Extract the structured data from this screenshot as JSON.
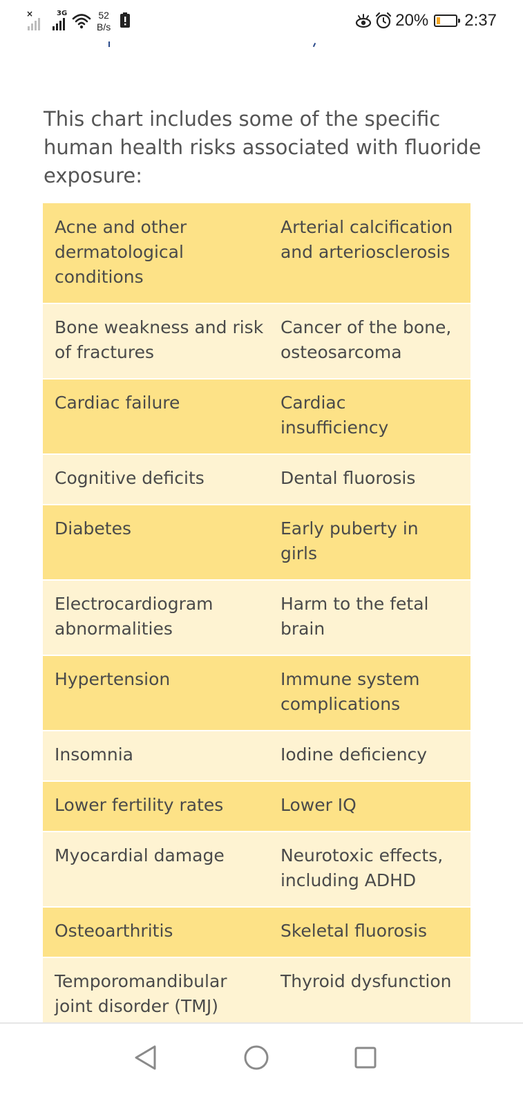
{
  "status_bar": {
    "network_type": "3G",
    "speed_value": "52",
    "speed_unit": "B/s",
    "battery_percent": "20%",
    "time": "2:37",
    "icons": [
      "no-signal-icon",
      "signal-icon",
      "wifi-icon",
      "battery-alert-icon",
      "eye-comfort-icon",
      "alarm-icon",
      "battery-icon"
    ],
    "battery_level": 0.2,
    "battery_color": "#f5a623"
  },
  "content": {
    "intro": "This chart includes some of the specific human health risks associated with fluoride exposure:"
  },
  "table": {
    "rows": [
      [
        "Acne and other dermatological conditions",
        "Arterial calcification and arteriosclerosis"
      ],
      [
        "Bone weakness and risk of fractures",
        "Cancer of the bone, osteosarcoma"
      ],
      [
        "Cardiac failure",
        "Cardiac insufficiency"
      ],
      [
        "Cognitive deficits",
        "Dental fluorosis"
      ],
      [
        "Diabetes",
        "Early puberty in girls"
      ],
      [
        "Electrocardiogram abnormalities",
        "Harm to the fetal brain"
      ],
      [
        "Hypertension",
        "Immune system complications"
      ],
      [
        "Insomnia",
        "Iodine deficiency"
      ],
      [
        "Lower fertility rates",
        "Lower IQ"
      ],
      [
        "Myocardial damage",
        "Neurotoxic effects, including ADHD"
      ],
      [
        "Osteoarthritis",
        "Skeletal fluorosis"
      ],
      [
        "Temporomandibular joint disorder (TMJ)",
        "Thyroid dysfunction"
      ]
    ],
    "colors": {
      "row_dark": "#fde287",
      "row_light": "#fef3d2",
      "text": "#4a4a4a"
    }
  },
  "nav_bar": {
    "buttons": [
      "back-triangle-icon",
      "home-circle-icon",
      "recents-square-icon"
    ]
  }
}
